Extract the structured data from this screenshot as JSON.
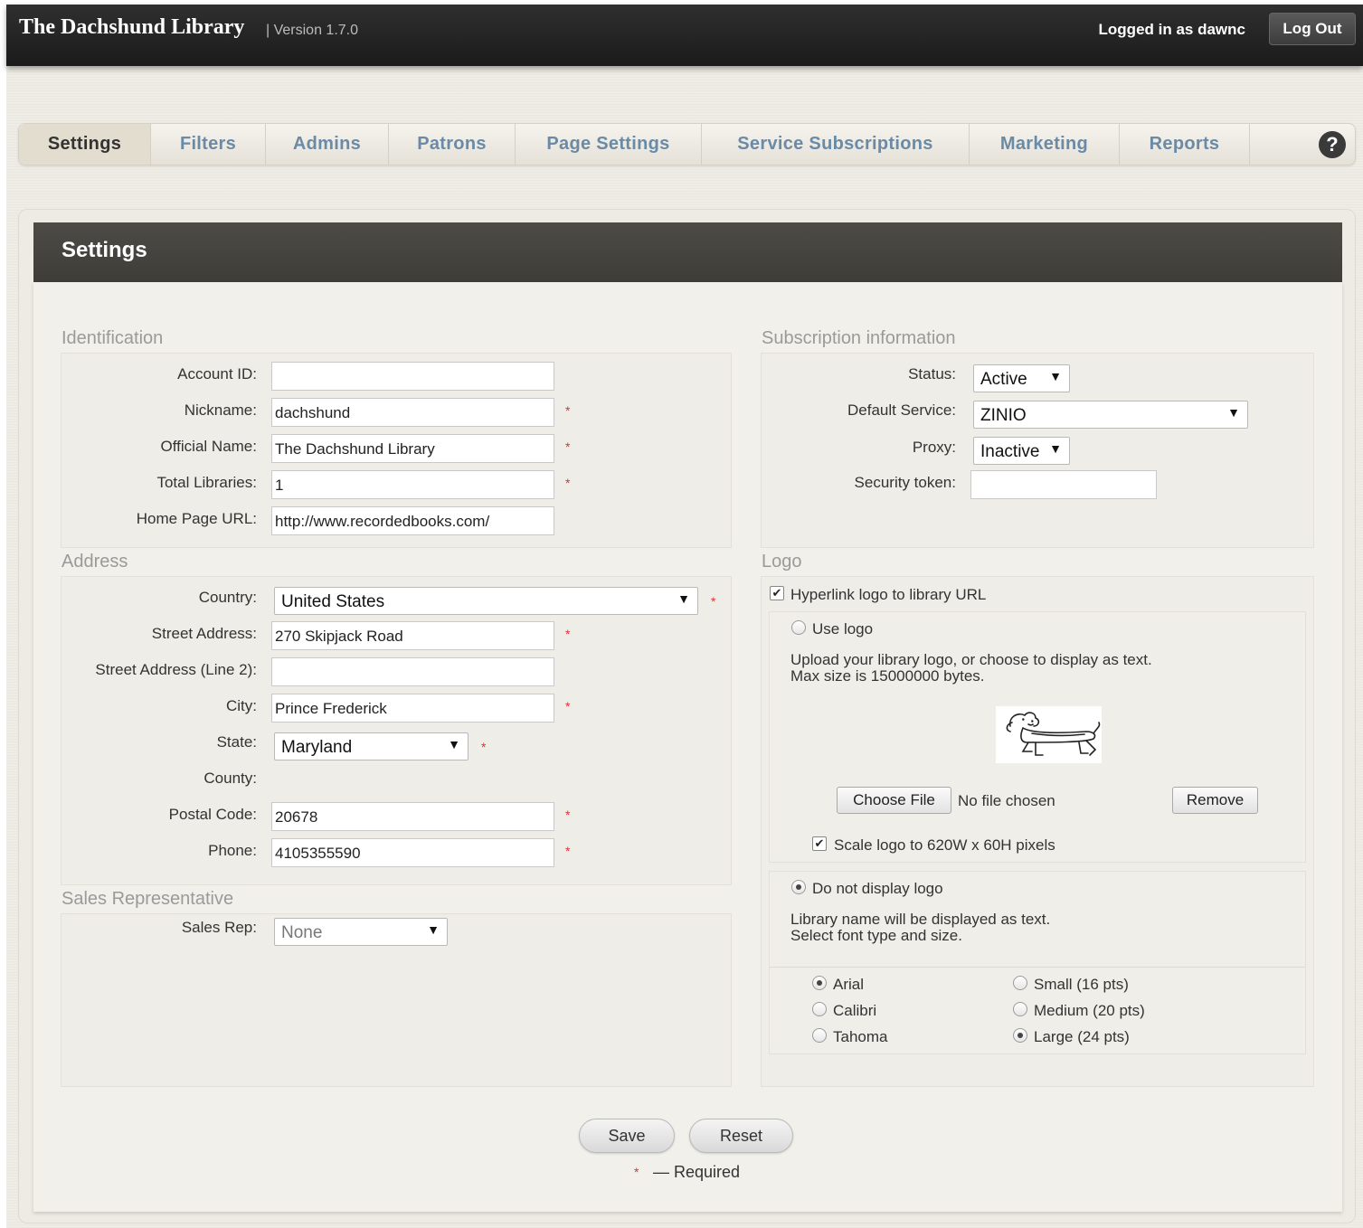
{
  "header": {
    "brand": "The Dachshund Library",
    "version": "| Version 1.7.0",
    "logged_in": "Logged in as dawnc",
    "logout_label": "Log Out"
  },
  "nav": {
    "tabs": [
      {
        "label": "Settings"
      },
      {
        "label": "Filters"
      },
      {
        "label": "Admins"
      },
      {
        "label": "Patrons"
      },
      {
        "label": "Page Settings"
      },
      {
        "label": "Service Subscriptions"
      },
      {
        "label": "Marketing"
      },
      {
        "label": "Reports"
      }
    ],
    "active": "Settings",
    "help_icon": "help-icon"
  },
  "panel": {
    "title": "Settings"
  },
  "identification": {
    "title": "Identification",
    "account_id": {
      "label": "Account ID:",
      "value": ""
    },
    "nickname": {
      "label": "Nickname:",
      "value": "dachshund"
    },
    "official_name": {
      "label": "Official Name:",
      "value": "The Dachshund Library"
    },
    "total_libraries": {
      "label": "Total Libraries:",
      "value": "1"
    },
    "home_page_url": {
      "label": "Home Page URL:",
      "value": "http://www.recordedbooks.com/"
    }
  },
  "address": {
    "title": "Address",
    "country": {
      "label": "Country:",
      "value": "United States"
    },
    "street": {
      "label": "Street Address:",
      "value": "270 Skipjack Road"
    },
    "street2": {
      "label": "Street Address (Line 2):",
      "value": ""
    },
    "city": {
      "label": "City:",
      "value": "Prince Frederick"
    },
    "state": {
      "label": "State:",
      "value": "Maryland"
    },
    "county": {
      "label": "County:"
    },
    "postal": {
      "label": "Postal Code:",
      "value": "20678"
    },
    "phone": {
      "label": "Phone:",
      "value": "4105355590"
    }
  },
  "sales": {
    "title": "Sales Representative",
    "rep": {
      "label": "Sales Rep:",
      "value": "None"
    }
  },
  "subscription": {
    "title": "Subscription information",
    "status": {
      "label": "Status:",
      "value": "Active"
    },
    "default_service": {
      "label": "Default Service:",
      "value": "ZINIO"
    },
    "proxy": {
      "label": "Proxy:",
      "value": "Inactive"
    },
    "security_token": {
      "label": "Security token:",
      "value": ""
    }
  },
  "logo": {
    "title": "Logo",
    "hyperlink_label": "Hyperlink logo to library URL",
    "use_logo_label": "Use logo",
    "upload_text_1": "Upload your library logo, or choose to display as text.",
    "upload_text_2": "Max size is 15000000 bytes.",
    "choose_file_label": "Choose File",
    "no_file_text": "No file chosen",
    "remove_label": "Remove",
    "scale_label": "Scale logo to 620W x 60H pixels",
    "no_logo_label": "Do not display logo",
    "text_info_1": "Library name will be displayed as text.",
    "text_info_2": "Select font type and size.",
    "fonts": [
      "Arial",
      "Calibri",
      "Tahoma"
    ],
    "sizes": [
      "Small (16 pts)",
      "Medium (20 pts)",
      "Large (24 pts)"
    ],
    "selected_font": "Arial",
    "selected_size": "Large (24 pts)"
  },
  "actions": {
    "save_label": "Save",
    "reset_label": "Reset",
    "required_star": "*",
    "required_text": "— Required"
  },
  "colors": {
    "header_bg": "#1f1f1f",
    "nav_link": "#6a8aa5",
    "required": "#d33333",
    "panel_head": "#46443f"
  }
}
